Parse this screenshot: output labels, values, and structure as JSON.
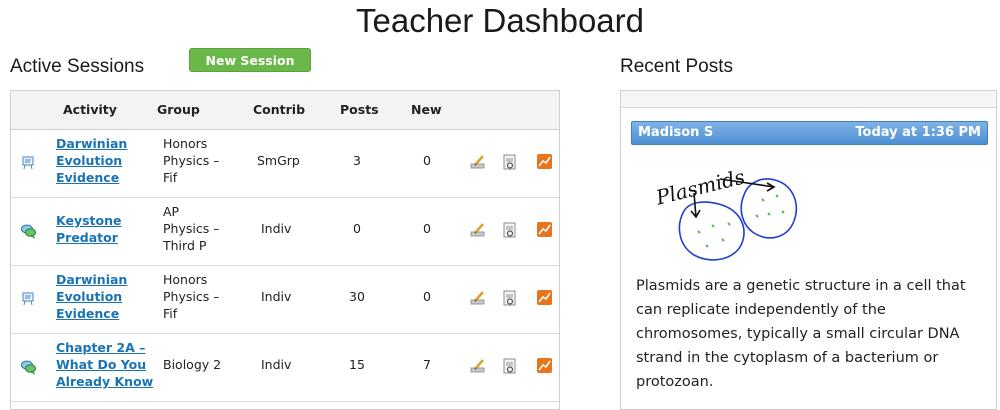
{
  "page": {
    "title": "Teacher Dashboard"
  },
  "sessions": {
    "heading": "Active Sessions",
    "new_button": "New Session",
    "columns": [
      "Activity",
      "Group",
      "Contrib",
      "Posts",
      "New"
    ],
    "rows": [
      {
        "type_icon": "whiteboard-icon",
        "activity": [
          "Darwinian",
          "Evolution",
          "Evidence"
        ],
        "group": [
          "Honors",
          "Physics –",
          "Fif"
        ],
        "contrib": "SmGrp",
        "posts": "3",
        "new": "0"
      },
      {
        "type_icon": "chat-bubbles-icon",
        "activity": [
          "Keystone",
          "Predator"
        ],
        "group": [
          "AP",
          "Physics –",
          "Third P"
        ],
        "contrib": "Indiv",
        "posts": "0",
        "new": "0"
      },
      {
        "type_icon": "whiteboard-icon",
        "activity": [
          "Darwinian",
          "Evolution",
          "Evidence"
        ],
        "group": [
          "Honors",
          "Physics –",
          "Fif"
        ],
        "contrib": "Indiv",
        "posts": "30",
        "new": "0"
      },
      {
        "type_icon": "chat-bubbles-icon",
        "activity": [
          "Chapter 2A –",
          "What Do You",
          "Already Know"
        ],
        "group": [
          "Biology 2"
        ],
        "contrib": "Indiv",
        "posts": "15",
        "new": "7"
      }
    ],
    "row_action_icons": [
      "edit-icon",
      "report-icon",
      "chart-icon"
    ]
  },
  "recent_posts": {
    "heading": "Recent Posts",
    "post": {
      "author": "Madison S",
      "time": "Today at 1:36 PM",
      "sketch_label": "Plasmids",
      "text": [
        "Plasmids are a genetic structure in a cell that",
        "can replicate independently of the",
        "chromosomes, typically a small circular DNA",
        "strand in the cytoplasm of a bacterium or",
        "protozoan."
      ]
    }
  },
  "colors": {
    "accent_green": "#6ab84a",
    "link_blue": "#1a73b5",
    "post_header_blue": "#4d8fd3",
    "sketch_blue": "#1f3fd0",
    "sketch_green": "#3bb34a"
  }
}
